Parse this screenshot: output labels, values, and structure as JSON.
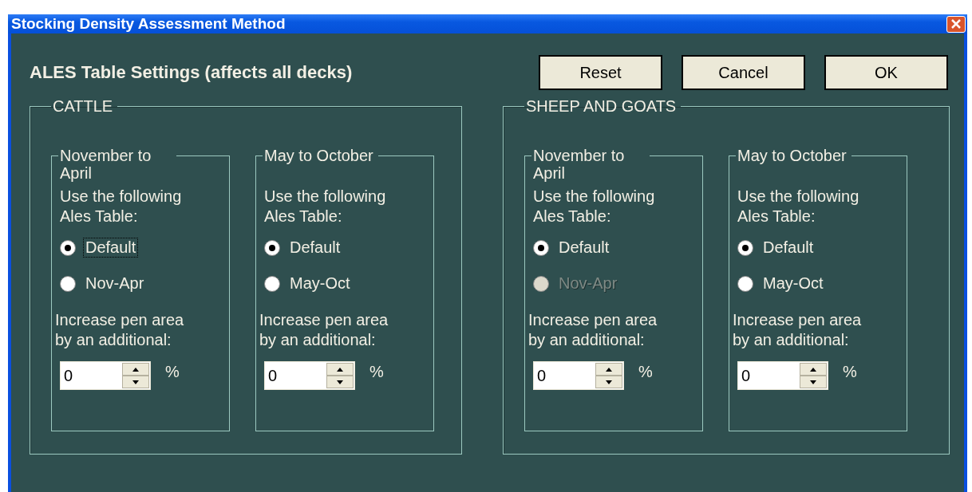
{
  "window": {
    "title": "Stocking Density Assessment Method"
  },
  "heading": "ALES Table Settings (affects all decks)",
  "buttons": [
    "Reset",
    "Cancel",
    "OK"
  ],
  "groups": [
    {
      "title": "CATTLE",
      "seasons": [
        {
          "title": "November to April",
          "prompt": "Use the following Ales Table:",
          "options": [
            {
              "label": "Default",
              "selected": true,
              "disabled": false,
              "focused": true
            },
            {
              "label": "Nov-Apr",
              "selected": false,
              "disabled": false,
              "focused": false
            }
          ],
          "increase_label": "Increase pen area by an additional:",
          "value": "0",
          "unit": "%"
        },
        {
          "title": "May to October",
          "prompt": "Use the following Ales Table:",
          "options": [
            {
              "label": "Default",
              "selected": true,
              "disabled": false,
              "focused": false
            },
            {
              "label": "May-Oct",
              "selected": false,
              "disabled": false,
              "focused": false
            }
          ],
          "increase_label": "Increase pen area by an additional:",
          "value": "0",
          "unit": "%"
        }
      ]
    },
    {
      "title": "SHEEP AND GOATS",
      "seasons": [
        {
          "title": "November to April",
          "prompt": "Use the following Ales Table:",
          "options": [
            {
              "label": "Default",
              "selected": true,
              "disabled": false,
              "focused": false
            },
            {
              "label": "Nov-Apr",
              "selected": false,
              "disabled": true,
              "focused": false
            }
          ],
          "increase_label": "Increase pen area by an additional:",
          "value": "0",
          "unit": "%"
        },
        {
          "title": "May to October",
          "prompt": "Use the following Ales Table:",
          "options": [
            {
              "label": "Default",
              "selected": true,
              "disabled": false,
              "focused": false
            },
            {
              "label": "May-Oct",
              "selected": false,
              "disabled": false,
              "focused": false
            }
          ],
          "increase_label": "Increase pen area by an additional:",
          "value": "0",
          "unit": "%"
        }
      ]
    }
  ]
}
